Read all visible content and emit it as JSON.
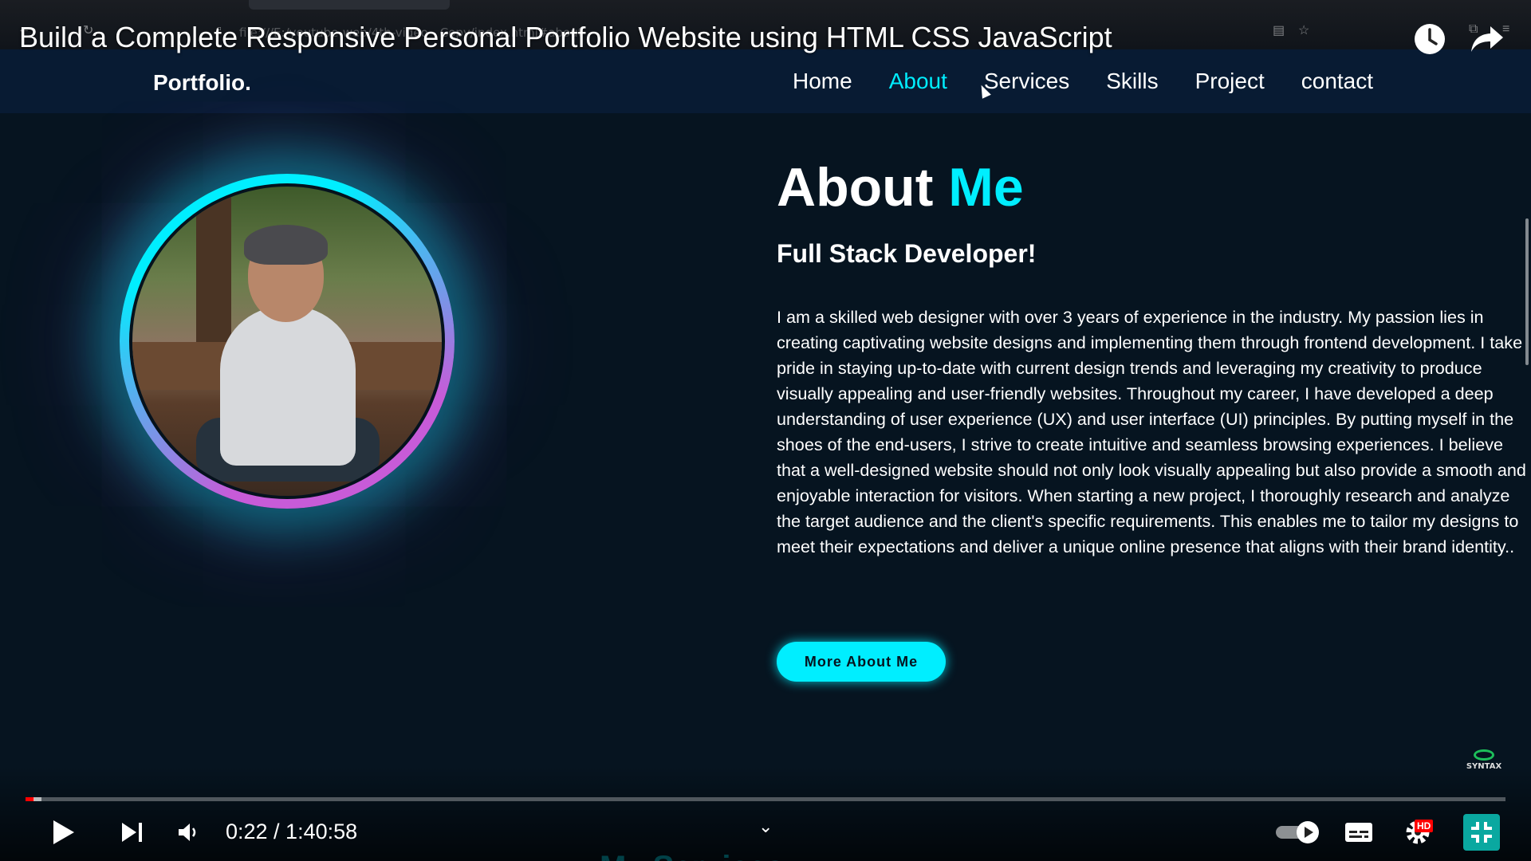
{
  "video": {
    "title": "Build a Complete Responsive Personal Portfolio Website using HTML CSS JavaScript",
    "url_ghost": "file:///E:/youtube-web/4th-video - Copy/index.html#about",
    "time": "0:22 / 1:40:58",
    "progress_fraction": 0.006,
    "watermark": "SYNTAX"
  },
  "site": {
    "logo": "Portfolio.",
    "nav": [
      {
        "label": "Home",
        "active": false
      },
      {
        "label": "About",
        "active": true
      },
      {
        "label": "Services",
        "active": false
      },
      {
        "label": "Skills",
        "active": false
      },
      {
        "label": "Project",
        "active": false
      },
      {
        "label": "contact",
        "active": false
      }
    ],
    "about": {
      "title_plain": "About ",
      "title_highlight": "Me",
      "subtitle": "Full Stack Developer!",
      "paragraph": "I am a skilled web designer with over 3 years of experience in the industry. My passion lies in creating captivating website designs and implementing them through frontend development. I take pride in staying up-to-date with current design trends and leveraging my creativity to produce visually appealing and user-friendly websites. Throughout my career, I have developed a deep understanding of user experience (UX) and user interface (UI) principles. By putting myself in the shoes of the end-users, I strive to create intuitive and seamless browsing experiences. I believe that a well-designed website should not only look visually appealing but also provide a smooth and enjoyable interaction for visitors. When starting a new project, I thoroughly research and analyze the target audience and the client's specific requirements. This enables me to tailor my designs to meet their expectations and deliver a unique online presence that aligns with their brand identity..",
      "button_label": "More About Me"
    },
    "ghost_text": "My Services"
  },
  "player": {
    "hd_label": "HD"
  },
  "colors": {
    "accent": "#00eeff",
    "background": "#061420",
    "navbar": "#081b33",
    "progress": "#ff0000"
  }
}
